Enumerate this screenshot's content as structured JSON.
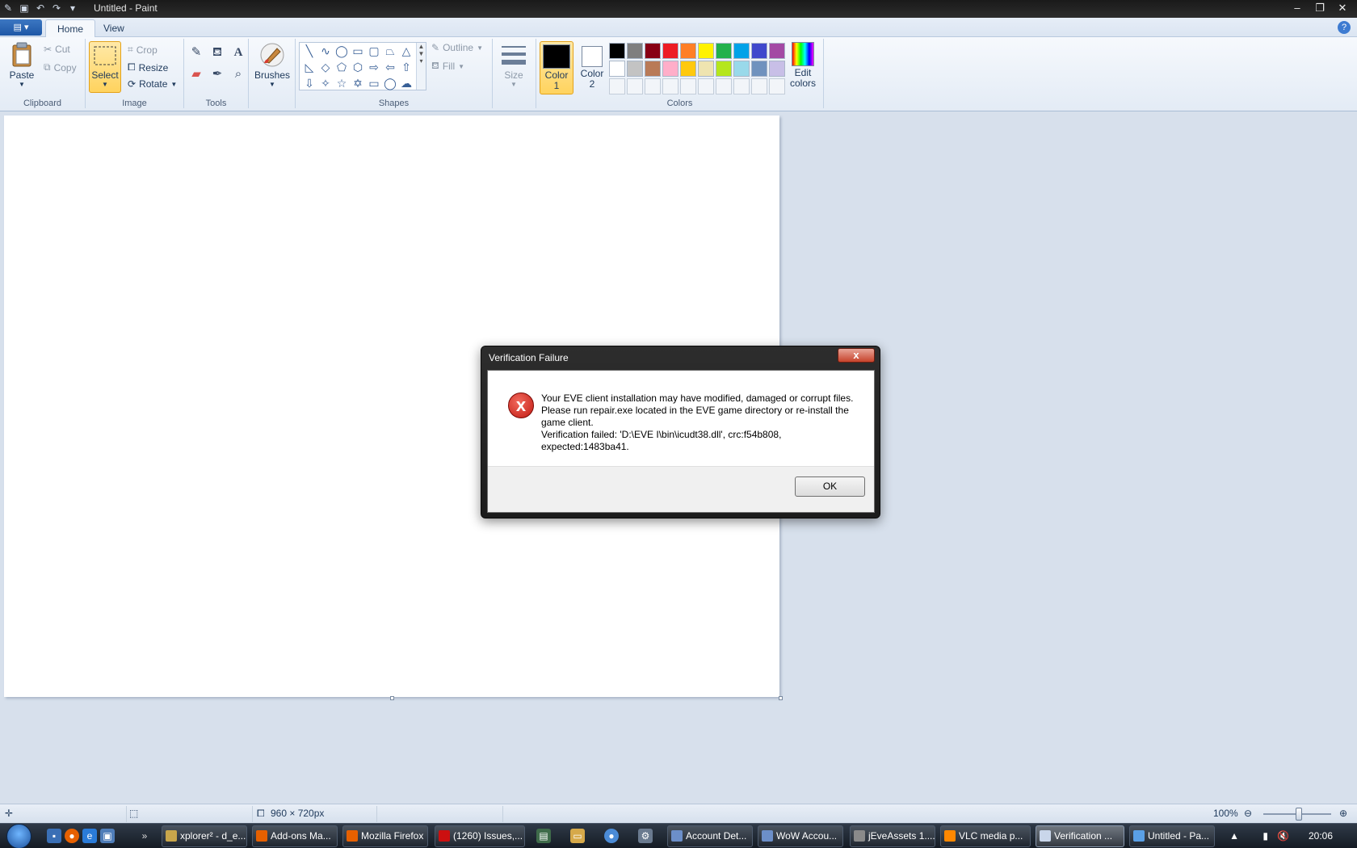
{
  "window": {
    "title": "Untitled - Paint",
    "qat_icons": [
      "paint-icon",
      "save-icon",
      "undo-icon",
      "redo-icon",
      "customize-icon"
    ],
    "controls": [
      "minimize",
      "restore",
      "close"
    ]
  },
  "ribbon_tabs": {
    "home": "Home",
    "view": "View"
  },
  "ribbon": {
    "clipboard": {
      "group_label": "Clipboard",
      "paste": "Paste",
      "cut": "Cut",
      "copy": "Copy"
    },
    "image": {
      "group_label": "Image",
      "select": "Select",
      "crop": "Crop",
      "resize": "Resize",
      "rotate": "Rotate"
    },
    "tools": {
      "group_label": "Tools",
      "items": [
        "pencil-icon",
        "fill-icon",
        "text-icon",
        "eraser-icon",
        "color-picker-icon",
        "magnifier-icon"
      ]
    },
    "brushes": {
      "label": "Brushes"
    },
    "shapes": {
      "group_label": "Shapes",
      "outline": "Outline",
      "fill": "Fill",
      "size": "Size"
    },
    "colors": {
      "group_label": "Colors",
      "color1": "Color 1",
      "color2": "Color 2",
      "color1_value": "#000000",
      "color2_value": "#ffffff",
      "edit_colors": "Edit colors",
      "palette_row1": [
        "#000000",
        "#7f7f7f",
        "#880015",
        "#ed1c24",
        "#ff7f27",
        "#fff200",
        "#22b14c",
        "#00a2e8",
        "#3f48cc",
        "#a349a4"
      ],
      "palette_row2": [
        "#ffffff",
        "#c3c3c3",
        "#b97a57",
        "#ffaec9",
        "#ffc90e",
        "#efe4b0",
        "#b5e61d",
        "#99d9ea",
        "#7092be",
        "#c8bfe7"
      ]
    }
  },
  "dialog": {
    "title": "Verification Failure",
    "close_glyph": "x",
    "error_glyph": "x",
    "message_line1": "Your EVE client installation may have modified, damaged or corrupt files. Please run repair.exe located in the EVE game directory or re-install the game client.",
    "message_line2": "Verification failed: 'D:\\EVE I\\bin\\icudt38.dll', crc:f54b808, expected:1483ba41.",
    "ok": "OK"
  },
  "statusbar": {
    "dimensions": "960 × 720px",
    "zoom": "100%",
    "zoom_level_percent": 100
  },
  "taskbar": {
    "buttons": [
      {
        "label": "xplorer² - d_e...",
        "color": "#c8a64b"
      },
      {
        "label": "Add-ons Ma...",
        "color": "#e66000"
      },
      {
        "label": "Mozilla Firefox",
        "color": "#e66000"
      },
      {
        "label": "(1260) Issues,...",
        "color": "#cc1010"
      },
      {
        "label": "Account Det...",
        "color": "#6c8fc9"
      },
      {
        "label": "WoW Accou...",
        "color": "#6c8fc9"
      },
      {
        "label": "jEveAssets 1....",
        "color": "#8a8a8a"
      },
      {
        "label": "VLC media p...",
        "color": "#ff8800"
      },
      {
        "label": "Verification ...",
        "color": "#c9d6ea"
      },
      {
        "label": "Untitled - Pa...",
        "color": "#5aa0e6"
      }
    ],
    "clock": "20:06"
  }
}
